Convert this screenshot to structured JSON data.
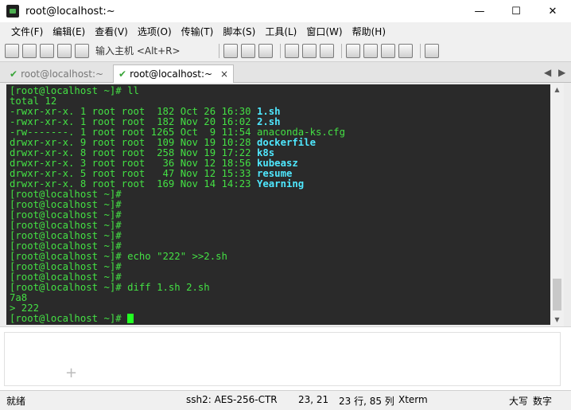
{
  "window": {
    "title": "root@localhost:~",
    "minimize": "—",
    "maximize": "☐",
    "close": "✕"
  },
  "menu": [
    "文件(F)",
    "编辑(E)",
    "查看(V)",
    "选项(O)",
    "传输(T)",
    "脚本(S)",
    "工具(L)",
    "窗口(W)",
    "帮助(H)"
  ],
  "toolbar": {
    "host_placeholder": "输入主机 <Alt+R>"
  },
  "tabs": [
    {
      "label": "root@localhost:~",
      "active": false
    },
    {
      "label": "root@localhost:~",
      "active": true,
      "close": "×"
    }
  ],
  "tab_nav": {
    "left": "◀",
    "right": "▶"
  },
  "terminal": {
    "lines": [
      [
        {
          "t": "[root@localhost ~]# ll",
          "c": "g"
        }
      ],
      [
        {
          "t": "total 12",
          "c": "g"
        }
      ],
      [
        {
          "t": "-rwxr-xr-x. 1 root root  182 Oct 26 16:30 ",
          "c": "g"
        },
        {
          "t": "1.sh",
          "c": "c"
        }
      ],
      [
        {
          "t": "-rwxr-xr-x. 1 root root  182 Nov 20 16:02 ",
          "c": "g"
        },
        {
          "t": "2.sh",
          "c": "c"
        }
      ],
      [
        {
          "t": "-rw-------. 1 root root 1265 Oct  9 11:54 anaconda-ks.cfg",
          "c": "g"
        }
      ],
      [
        {
          "t": "drwxr-xr-x. 9 root root  109 Nov 19 10:28 ",
          "c": "g"
        },
        {
          "t": "dockerfile",
          "c": "c"
        }
      ],
      [
        {
          "t": "drwxr-xr-x. 8 root root  258 Nov 19 17:22 ",
          "c": "g"
        },
        {
          "t": "k8s",
          "c": "c"
        }
      ],
      [
        {
          "t": "drwxr-xr-x. 3 root root   36 Nov 12 18:56 ",
          "c": "g"
        },
        {
          "t": "kubeasz",
          "c": "c"
        }
      ],
      [
        {
          "t": "drwxr-xr-x. 5 root root   47 Nov 12 15:33 ",
          "c": "g"
        },
        {
          "t": "resume",
          "c": "c"
        }
      ],
      [
        {
          "t": "drwxr-xr-x. 8 root root  169 Nov 14 14:23 ",
          "c": "g"
        },
        {
          "t": "Yearning",
          "c": "c"
        }
      ],
      [
        {
          "t": "[root@localhost ~]#",
          "c": "g"
        }
      ],
      [
        {
          "t": "[root@localhost ~]#",
          "c": "g"
        }
      ],
      [
        {
          "t": "[root@localhost ~]#",
          "c": "g"
        }
      ],
      [
        {
          "t": "[root@localhost ~]#",
          "c": "g"
        }
      ],
      [
        {
          "t": "[root@localhost ~]#",
          "c": "g"
        }
      ],
      [
        {
          "t": "[root@localhost ~]#",
          "c": "g"
        }
      ],
      [
        {
          "t": "[root@localhost ~]# echo \"222\" >>2.sh",
          "c": "g"
        }
      ],
      [
        {
          "t": "[root@localhost ~]#",
          "c": "g"
        }
      ],
      [
        {
          "t": "[root@localhost ~]#",
          "c": "g"
        }
      ],
      [
        {
          "t": "[root@localhost ~]# diff 1.sh 2.sh",
          "c": "g"
        }
      ],
      [
        {
          "t": "7a8",
          "c": "g"
        }
      ],
      [
        {
          "t": "> 222",
          "c": "g"
        }
      ],
      [
        {
          "t": "[root@localhost ~]# ",
          "c": "g"
        }
      ]
    ]
  },
  "scrollbar": {
    "up": "▲",
    "down": "▼"
  },
  "lower_panel": {
    "plus": "+"
  },
  "status": {
    "ready": "就绪",
    "session": "ssh2: AES-256-CTR",
    "cursor_pos": "23,  21",
    "size": "23 行, 85 列",
    "term": "Xterm",
    "caps": "大写",
    "num": "数字"
  },
  "colors": {
    "terminal_bg": "#2a2a2a",
    "term_green": "#44e044",
    "term_cyan": "#4fe8ff",
    "cursor": "#22ff22"
  }
}
